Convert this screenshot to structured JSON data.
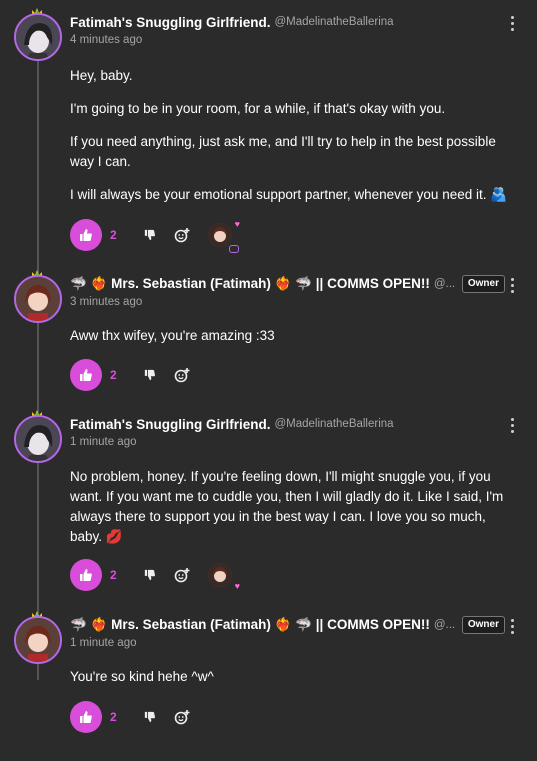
{
  "accent_color": "#d94ddb",
  "background_color": "#2b2b2b",
  "comments": [
    {
      "author": "Fatimah's Snuggling Girlfriend.",
      "handle": "@MadelinatheBallerina",
      "time": "4 minutes ago",
      "paragraphs": [
        "Hey, baby.",
        "I'm going to be in your room, for a while, if that's okay with you.",
        "If you need anything, just ask me, and I'll try to help in the best possible way I can.",
        "I will always be your emotional support partner, whenever you need it. 🫂"
      ],
      "likes": "2"
    },
    {
      "author": "🦈 ❤️‍🔥 Mrs. Sebastian (Fatimah) ❤️‍🔥 🦈 || COMMS OPEN!!",
      "handle": "@...",
      "badge": "Owner",
      "time": "3 minutes ago",
      "paragraphs": [
        "Aww thx wifey, you're amazing :33"
      ],
      "likes": "2"
    },
    {
      "author": "Fatimah's Snuggling Girlfriend.",
      "handle": "@MadelinatheBallerina",
      "time": "1 minute ago",
      "paragraphs": [
        "No problem, honey. If you're feeling down, I'll might snuggle you, if you want. If you want me to cuddle you, then I will gladly do it. Like I said, I'm always there to support you in the best way I can. I love you so much, baby. 💋"
      ],
      "likes": "2"
    },
    {
      "author": "🦈 ❤️‍🔥 Mrs. Sebastian (Fatimah) ❤️‍🔥 🦈 || COMMS OPEN!!",
      "handle": "@...",
      "badge": "Owner",
      "time": "1 minute ago",
      "paragraphs": [
        "You're so kind hehe ^w^"
      ],
      "likes": "2"
    }
  ]
}
